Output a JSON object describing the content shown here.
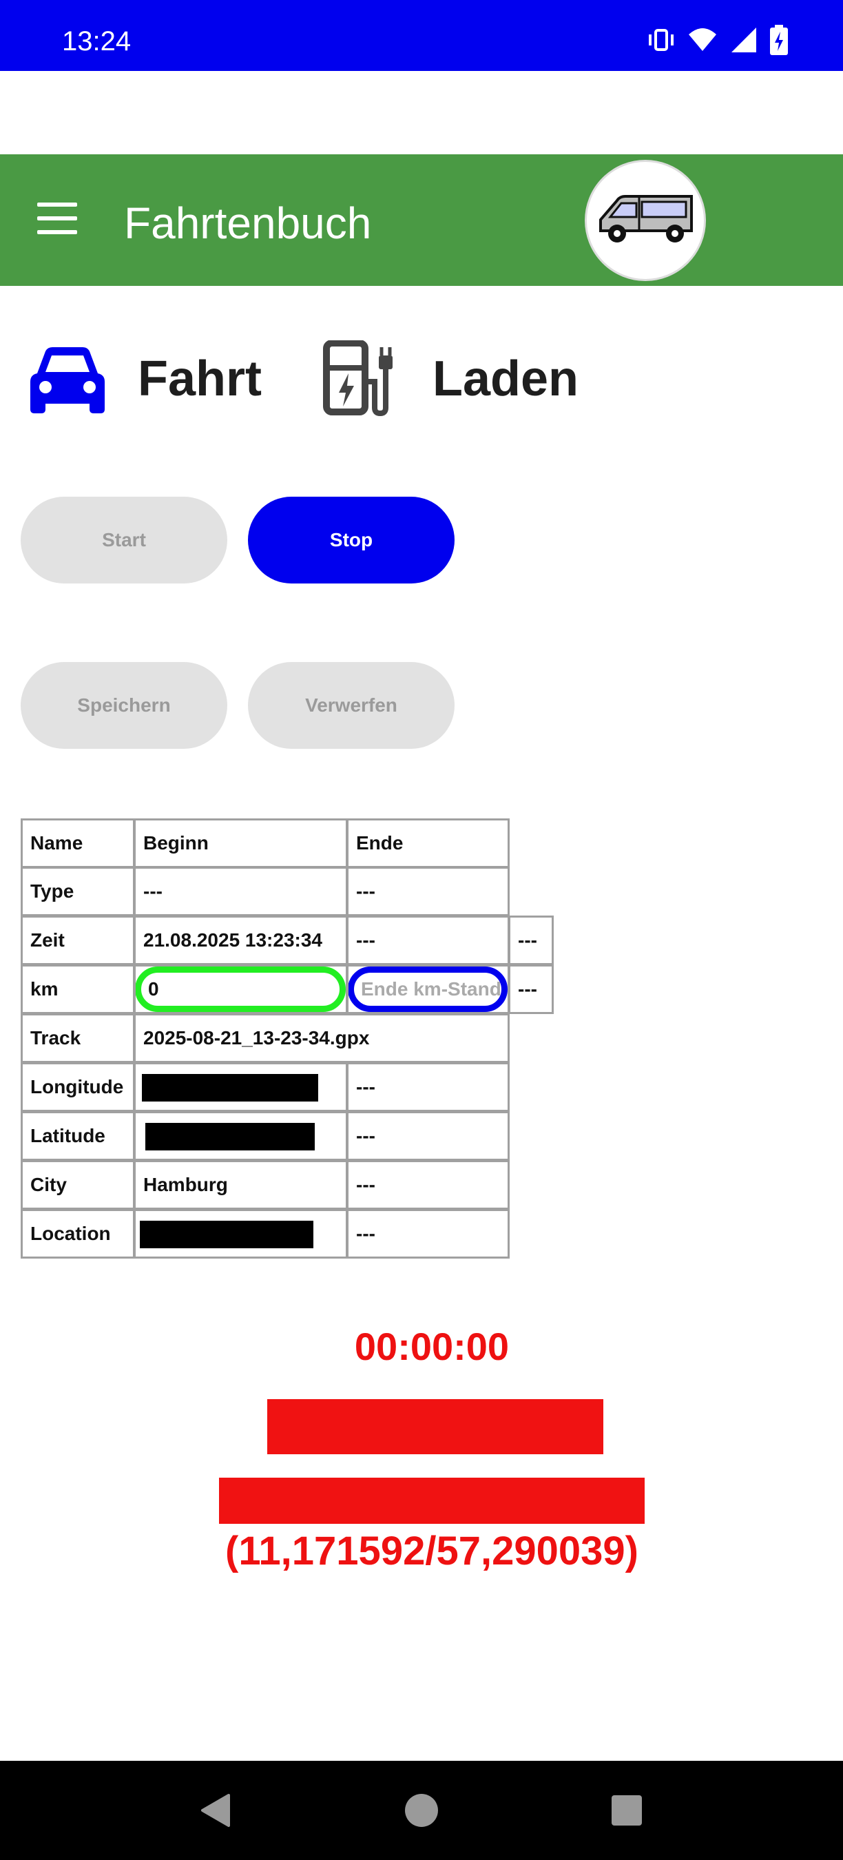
{
  "status_bar": {
    "time": "13:24",
    "icons": [
      "vibrate-icon",
      "wifi-icon",
      "signal-icon",
      "battery-charging-icon"
    ]
  },
  "app_bar": {
    "title": "Fahrtenbuch",
    "menu_icon": "hamburger-menu-icon",
    "avatar_icon": "van-icon",
    "color": "#4a9a44"
  },
  "modes": {
    "drive_label": "Fahrt",
    "drive_icon": "car-icon",
    "drive_color": "#0000ee",
    "charge_label": "Laden",
    "charge_icon": "ev-charger-icon"
  },
  "buttons": {
    "start": "Start",
    "stop": "Stop",
    "save": "Speichern",
    "discard": "Verwerfen",
    "active_color": "#0000ee"
  },
  "table": {
    "headers": {
      "name": "Name",
      "begin": "Beginn",
      "end": "Ende"
    },
    "rows": {
      "type": {
        "label": "Type",
        "begin": "---",
        "end": "---"
      },
      "zeit": {
        "label": "Zeit",
        "begin": "21.08.2025 13:23:34",
        "end": "---",
        "extra": "---"
      },
      "km": {
        "label": "km",
        "begin_value": "0",
        "end_placeholder": "Ende km-Stand",
        "extra": "---"
      },
      "track": {
        "label": "Track",
        "value": "2025-08-21_13-23-34.gpx"
      },
      "longitude": {
        "label": "Longitude",
        "end": "---"
      },
      "latitude": {
        "label": "Latitude",
        "end": "---"
      },
      "city": {
        "label": "City",
        "begin": "Hamburg",
        "end": "---"
      },
      "location": {
        "label": "Location",
        "end": "---"
      }
    }
  },
  "timer": "00:00:00",
  "coordinates": "(11,171592/57,290039)",
  "accent_red": "#ee1111",
  "nav": [
    "back-icon",
    "home-icon",
    "recents-icon"
  ]
}
